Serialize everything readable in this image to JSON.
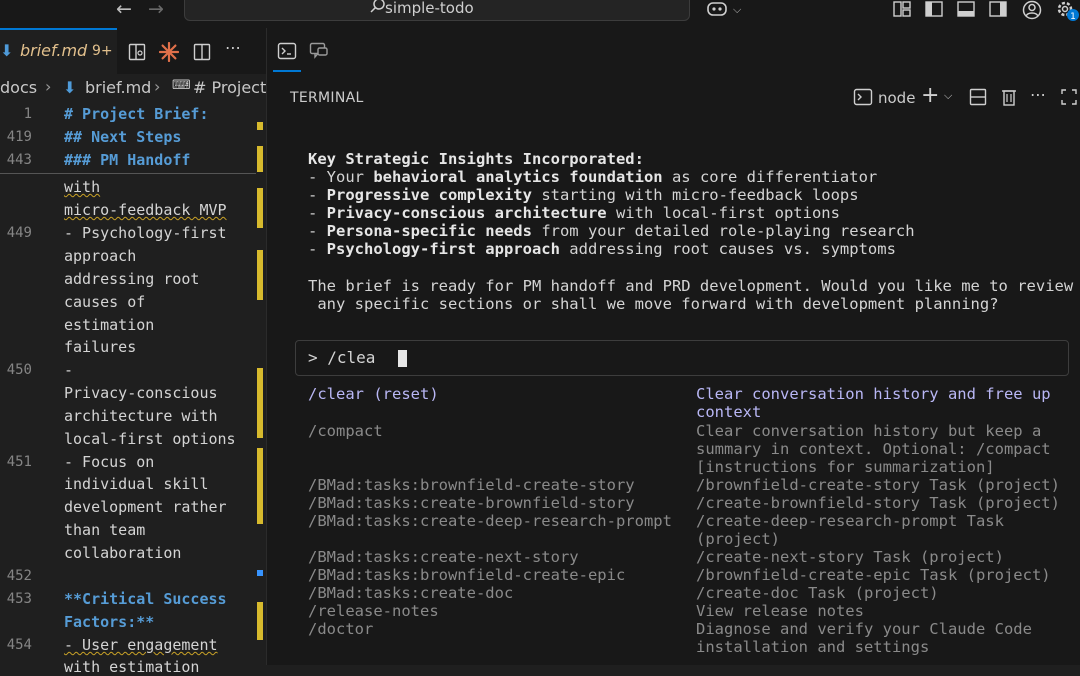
{
  "titlebar": {
    "search_label": "simple-todo"
  },
  "editor": {
    "tab": {
      "name": "brief.md",
      "count": "9+"
    },
    "breadcrumb": [
      "docs",
      "brief.md",
      "# Project"
    ],
    "lines": [
      {
        "num": "1",
        "text": "# Project Brief:"
      },
      {
        "num": "419",
        "text": "## Next Steps"
      },
      {
        "num": "443",
        "text": "### PM Handoff"
      },
      {
        "num": "",
        "text": "with"
      },
      {
        "num": "",
        "text": "micro-feedback MVP"
      },
      {
        "num": "449",
        "text": "- Psychology-first"
      },
      {
        "num": "",
        "text": "approach"
      },
      {
        "num": "",
        "text": "addressing root"
      },
      {
        "num": "",
        "text": "causes of"
      },
      {
        "num": "",
        "text": "estimation"
      },
      {
        "num": "",
        "text": "failures"
      },
      {
        "num": "450",
        "text": "-"
      },
      {
        "num": "",
        "text": "Privacy-conscious"
      },
      {
        "num": "",
        "text": "architecture with"
      },
      {
        "num": "",
        "text": "local-first options"
      },
      {
        "num": "451",
        "text": "- Focus on"
      },
      {
        "num": "",
        "text": "individual skill"
      },
      {
        "num": "",
        "text": "development rather"
      },
      {
        "num": "",
        "text": "than team"
      },
      {
        "num": "",
        "text": "collaboration"
      },
      {
        "num": "452",
        "text": ""
      },
      {
        "num": "453",
        "text": "**Critical Success"
      },
      {
        "num": "",
        "text": "Factors:**"
      },
      {
        "num": "454",
        "text": "- User engagement"
      },
      {
        "num": "",
        "text": "with estimation"
      }
    ]
  },
  "terminal": {
    "title": "TERMINAL",
    "shell": "node",
    "insights_heading": "Key Strategic Insights Incorporated:",
    "insights": [
      {
        "pre": "- Your ",
        "bold": "behavioral analytics foundation",
        "post": " as core differentiator"
      },
      {
        "pre": "- ",
        "bold": "Progressive complexity",
        "post": " starting with micro-feedback loops"
      },
      {
        "pre": "- ",
        "bold": "Privacy-conscious architecture",
        "post": " with local-first options"
      },
      {
        "pre": "- ",
        "bold": "Persona-specific needs",
        "post": " from your detailed role-playing research"
      },
      {
        "pre": "- ",
        "bold": "Psychology-first approach",
        "post": " addressing root causes vs. symptoms"
      }
    ],
    "closing_line1": "The brief is ready for PM handoff and PRD development. Would you like me to review",
    "closing_line2": " any specific sections or shall we move forward with development planning?",
    "input_value": "> /clea",
    "suggestions": [
      {
        "cmd": "/clear (reset)",
        "desc": [
          "Clear conversation history and free up",
          "context"
        ],
        "selected": true
      },
      {
        "cmd": "/compact",
        "desc": [
          "Clear conversation history but keep a",
          "summary in context. Optional: /compact",
          "[instructions for summarization]"
        ]
      },
      {
        "cmd": "/BMad:tasks:brownfield-create-story",
        "desc": [
          "/brownfield-create-story Task (project)"
        ]
      },
      {
        "cmd": "/BMad:tasks:create-brownfield-story",
        "desc": [
          "/create-brownfield-story Task (project)"
        ]
      },
      {
        "cmd": "/BMad:tasks:create-deep-research-prompt",
        "desc": [
          "/create-deep-research-prompt Task",
          "(project)"
        ]
      },
      {
        "cmd": "/BMad:tasks:create-next-story",
        "desc": [
          "/create-next-story Task (project)"
        ]
      },
      {
        "cmd": "/BMad:tasks:brownfield-create-epic",
        "desc": [
          "/brownfield-create-epic Task (project)"
        ]
      },
      {
        "cmd": "/BMad:tasks:create-doc",
        "desc": [
          "/create-doc Task (project)"
        ]
      },
      {
        "cmd": "/release-notes",
        "desc": [
          "View release notes"
        ]
      },
      {
        "cmd": "/doctor",
        "desc": [
          "Diagnose and verify your Claude Code",
          "installation and settings"
        ]
      }
    ]
  },
  "colors": {
    "accent": "#0078d4",
    "modified": "#e2c08d",
    "heading": "#569cd6",
    "selected_cmd": "#b9b7f5"
  }
}
